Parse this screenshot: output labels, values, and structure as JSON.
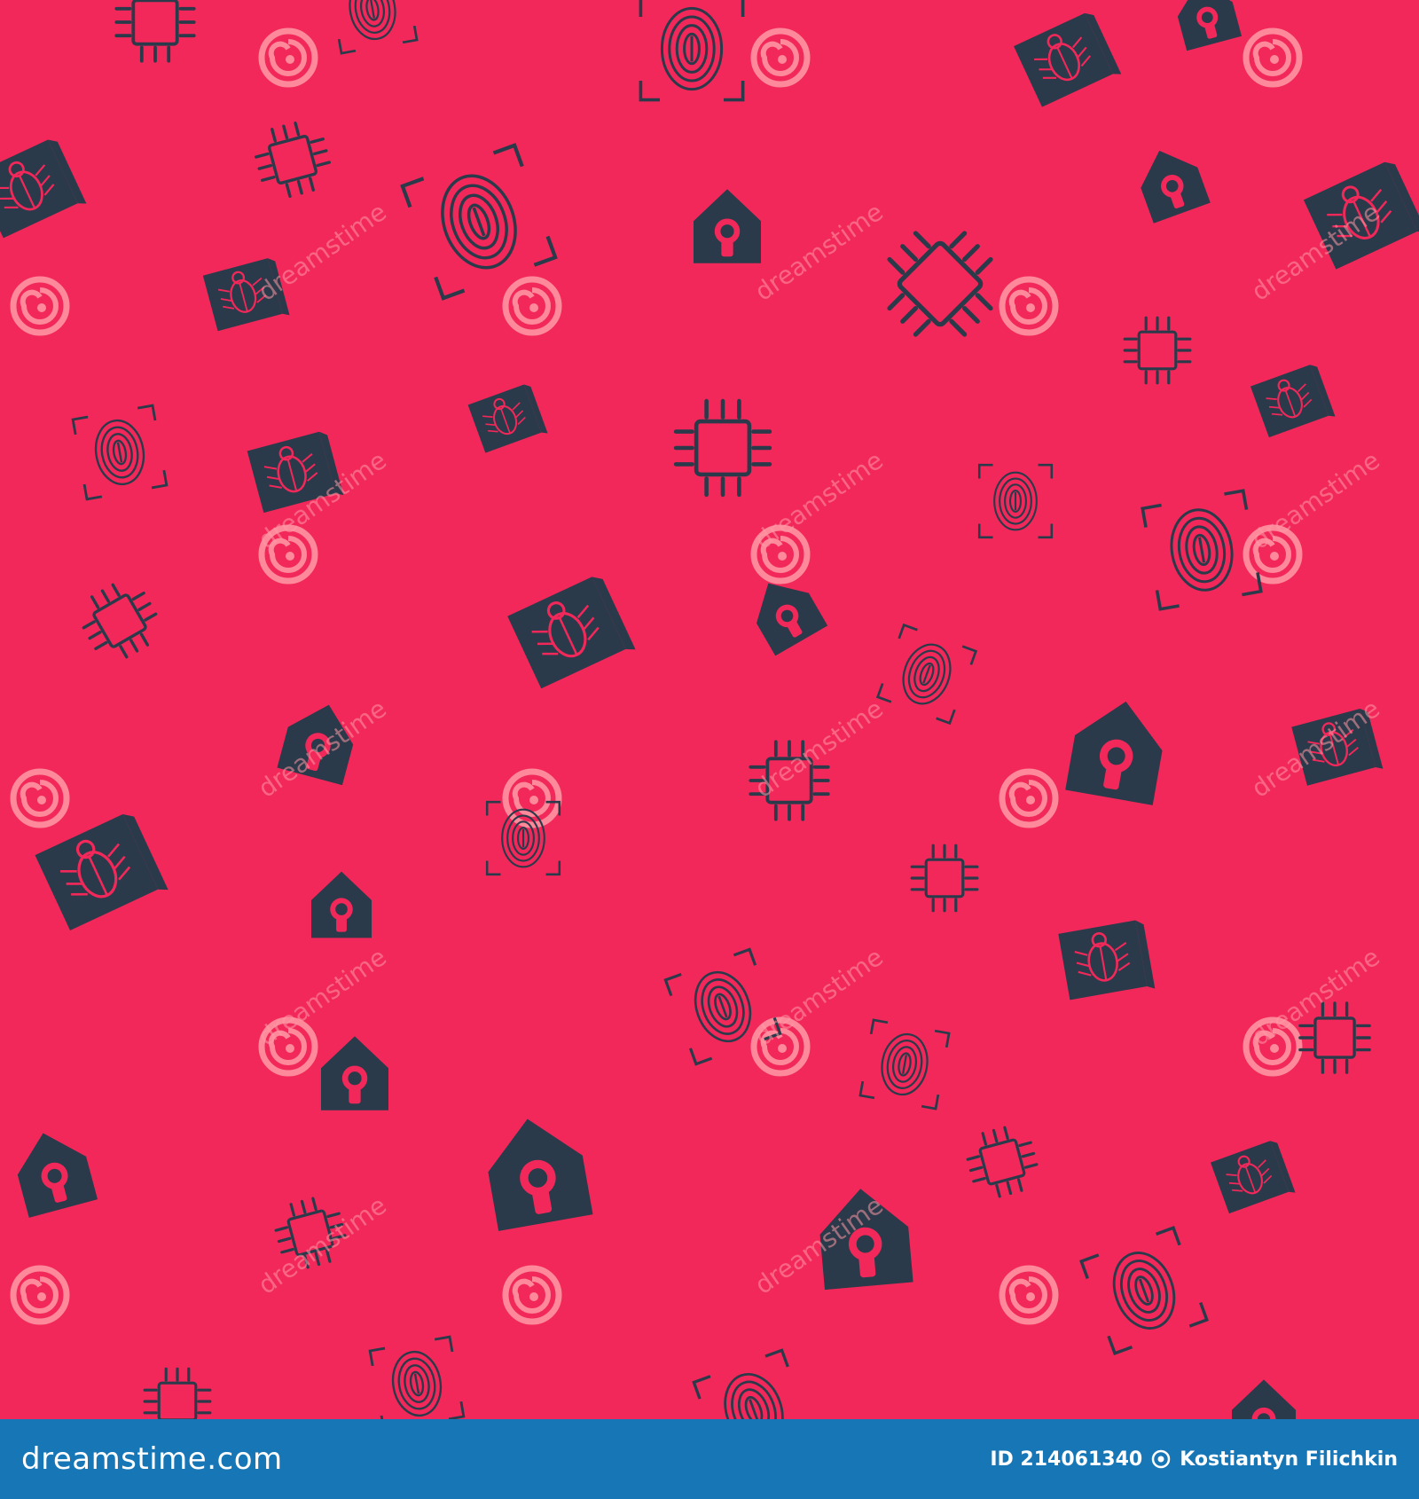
{
  "colors": {
    "background": "#f3285a",
    "icon": "#2a3a4a",
    "watermark": "#ff9aa6",
    "footer": "#1676b6",
    "footer_text": "#ffffff"
  },
  "pattern": {
    "watermark_text": "dreamstime",
    "icon_types": [
      "processor-chip-icon",
      "fingerprint-scan-icon",
      "laptop-bug-icon",
      "house-lock-icon"
    ]
  },
  "footer": {
    "brand": "dreamstime.com",
    "id_text": "ID 214061340",
    "author": "Kostiantyn Filichkin",
    "author_icon": "copyright-icon"
  }
}
